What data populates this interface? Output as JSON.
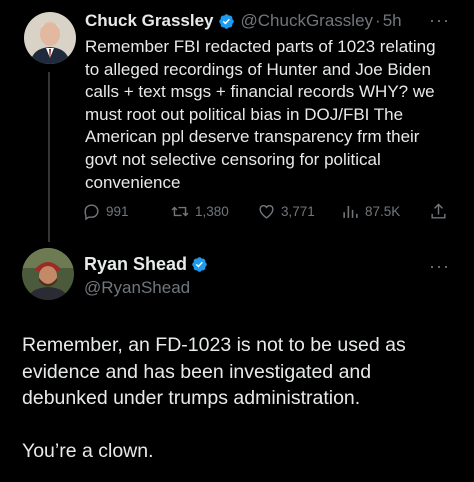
{
  "parent_tweet": {
    "display_name": "Chuck Grassley",
    "handle": "@ChuckGrassley",
    "separator": "·",
    "time": "5h",
    "more": "···",
    "text": "Remember FBI redacted parts of 1023 relating\nto alleged recordings of Hunter and Joe Biden\ncalls + text msgs + financial records WHY? we\nmust root out political bias in DOJ/FBI The\nAmerican ppl deserve transparency frm their\ngovt not selective censoring for political\nconvenience",
    "actions": {
      "replies": "991",
      "retweets": "1,380",
      "likes": "3,771",
      "views": "87.5K"
    }
  },
  "reply_tweet": {
    "display_name": "Ryan Shead",
    "handle": "@RyanShead",
    "more": "···",
    "text": "Remember, an FD-1023 is not to be used as\nevidence and has been investigated and\ndebunked under trumps administration.\n\nYou’re a clown."
  },
  "colors": {
    "background": "#000000",
    "text": "#e7e9ea",
    "secondary": "#71767b",
    "verified": "#1d9bf0"
  },
  "icons": [
    "verified-badge-icon",
    "reply-icon",
    "retweet-icon",
    "like-icon",
    "views-icon",
    "share-icon",
    "more-icon"
  ]
}
